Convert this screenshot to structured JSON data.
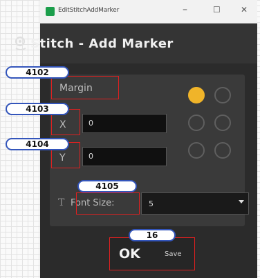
{
  "window": {
    "title": "EditStitchAddMarker",
    "minimize": "–",
    "maximize": "☐",
    "close": "✕"
  },
  "header": {
    "title": "Stitch - Add Marker"
  },
  "margin": {
    "label": "Margin",
    "x_label": "X",
    "x_value": "0",
    "y_label": "Y",
    "y_value": "0"
  },
  "font_size": {
    "label": "Font Size:",
    "value": "5"
  },
  "buttons": {
    "ok": "OK",
    "save": "Save"
  },
  "annotations": [
    "4102",
    "4103",
    "4104",
    "4105",
    "16"
  ],
  "colors": {
    "accent": "#f0b429",
    "highlight_box": "#e02020",
    "annotation_border": "#3355bb"
  },
  "icons": [
    "app-icon",
    "pin-icon",
    "dropdown-arrow-icon"
  ]
}
